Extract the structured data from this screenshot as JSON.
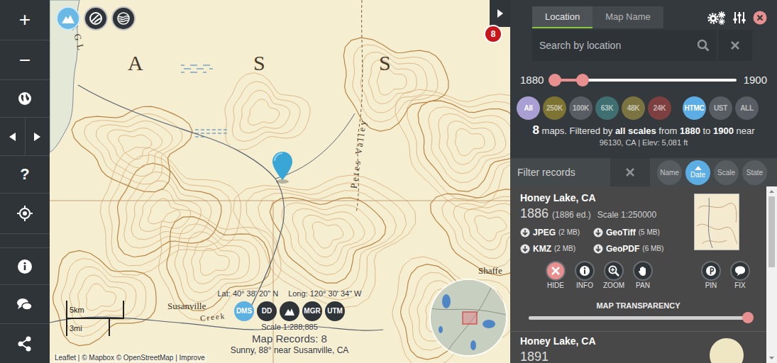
{
  "toolbar": {
    "zoom_in": "+",
    "zoom_out": "−",
    "help": "?"
  },
  "map": {
    "layers": [
      {
        "selected": true
      },
      {
        "selected": false
      },
      {
        "selected": false
      }
    ],
    "labels": [
      "A",
      "S",
      "S",
      "AGL",
      "Petes Valley",
      "Susanville",
      "Creek",
      "Shaffe"
    ],
    "badge": "8",
    "scale_bar": {
      "km": "5km",
      "mi": "3mi"
    },
    "coordinates": {
      "lat": "Lat: 40° 38' 20\" N",
      "long": "Long: 120° 30' 34\" W"
    },
    "coord_formats": [
      {
        "kind": "text",
        "label": "DMS",
        "selected": true
      },
      {
        "kind": "text",
        "label": "DD",
        "selected": false
      },
      {
        "kind": "icon",
        "selected": false
      },
      {
        "kind": "text",
        "label": "MGR",
        "selected": false
      },
      {
        "kind": "text",
        "label": "UTM",
        "selected": false
      }
    ],
    "scale": "Scale 1:288,885",
    "records": "Map Records: 8",
    "weather": "Sunny, 88° near Susanville, CA",
    "attribution": "Leaflet | © Mapbox © OpenStreetMap | Improve"
  },
  "panel": {
    "tabs": [
      {
        "label": "Location",
        "selected": true
      },
      {
        "label": "Map Name",
        "selected": false
      }
    ],
    "search": {
      "placeholder": "Search by location"
    },
    "years": {
      "min": "1880",
      "max": "1900",
      "low": 0.02,
      "high": 0.17
    },
    "scales": [
      {
        "label": "All",
        "selected": true,
        "color": "#a99fd2"
      },
      {
        "label": "250K",
        "selected": false,
        "color": "#7d7332"
      },
      {
        "label": "100K",
        "selected": false,
        "color": "#575d62"
      },
      {
        "label": "63K",
        "selected": false,
        "color": "#3f6f70"
      },
      {
        "label": "48K",
        "selected": false,
        "color": "#7b7442"
      },
      {
        "label": "24K",
        "selected": false,
        "color": "#7d3f3f"
      },
      {
        "label": "HTMC",
        "selected": true,
        "color": "#5cade3"
      },
      {
        "label": "UST",
        "selected": false,
        "color": "#575d62"
      },
      {
        "label": "ALL",
        "selected": false,
        "color": "#575d62"
      }
    ],
    "summary": [
      {
        "text": "8",
        "bold": true
      },
      {
        "text": " maps. Filtered by ",
        "bold": false
      },
      {
        "text": "all scales",
        "bold": true
      },
      {
        "text": " from ",
        "bold": false
      },
      {
        "text": "1880",
        "bold": true
      },
      {
        "text": " to ",
        "bold": false
      },
      {
        "text": "1900",
        "bold": true
      },
      {
        "text": " near",
        "bold": false
      }
    ],
    "location": "96130, CA | Elev: 5,081 ft",
    "filter": {
      "placeholder": "Filter records"
    },
    "sort": [
      {
        "label": "Name",
        "selected": false
      },
      {
        "label": "Date",
        "selected": true
      },
      {
        "label": "Scale",
        "selected": false
      },
      {
        "label": "State",
        "selected": false
      }
    ],
    "records": [
      {
        "title": "Honey Lake, CA",
        "year": "1886",
        "edition": "(1886 ed.)",
        "scale": "Scale 1:250000",
        "downloads": [
          {
            "label": "JPEG",
            "size": "(2 MB)"
          },
          {
            "label": "GeoTiff",
            "size": "(5 MB)"
          },
          {
            "label": "KMZ",
            "size": "(2 MB)"
          },
          {
            "label": "GeoPDF",
            "size": "(6 MB)"
          }
        ],
        "actions": [
          {
            "label": "HIDE",
            "color": "#e8908f"
          },
          {
            "label": "INFO",
            "color": "#2f3439"
          },
          {
            "label": "ZOOM",
            "color": "#2f3439"
          },
          {
            "label": "PAN",
            "color": "#2f3439"
          },
          {
            "label": "PIN",
            "color": "#2f3439"
          },
          {
            "label": "FIX",
            "color": "#2f3439"
          }
        ],
        "transparency_label": "MAP TRANSPARENCY",
        "transparency": 1
      },
      {
        "title": "Honey Lake, CA",
        "year": "1891"
      }
    ]
  }
}
